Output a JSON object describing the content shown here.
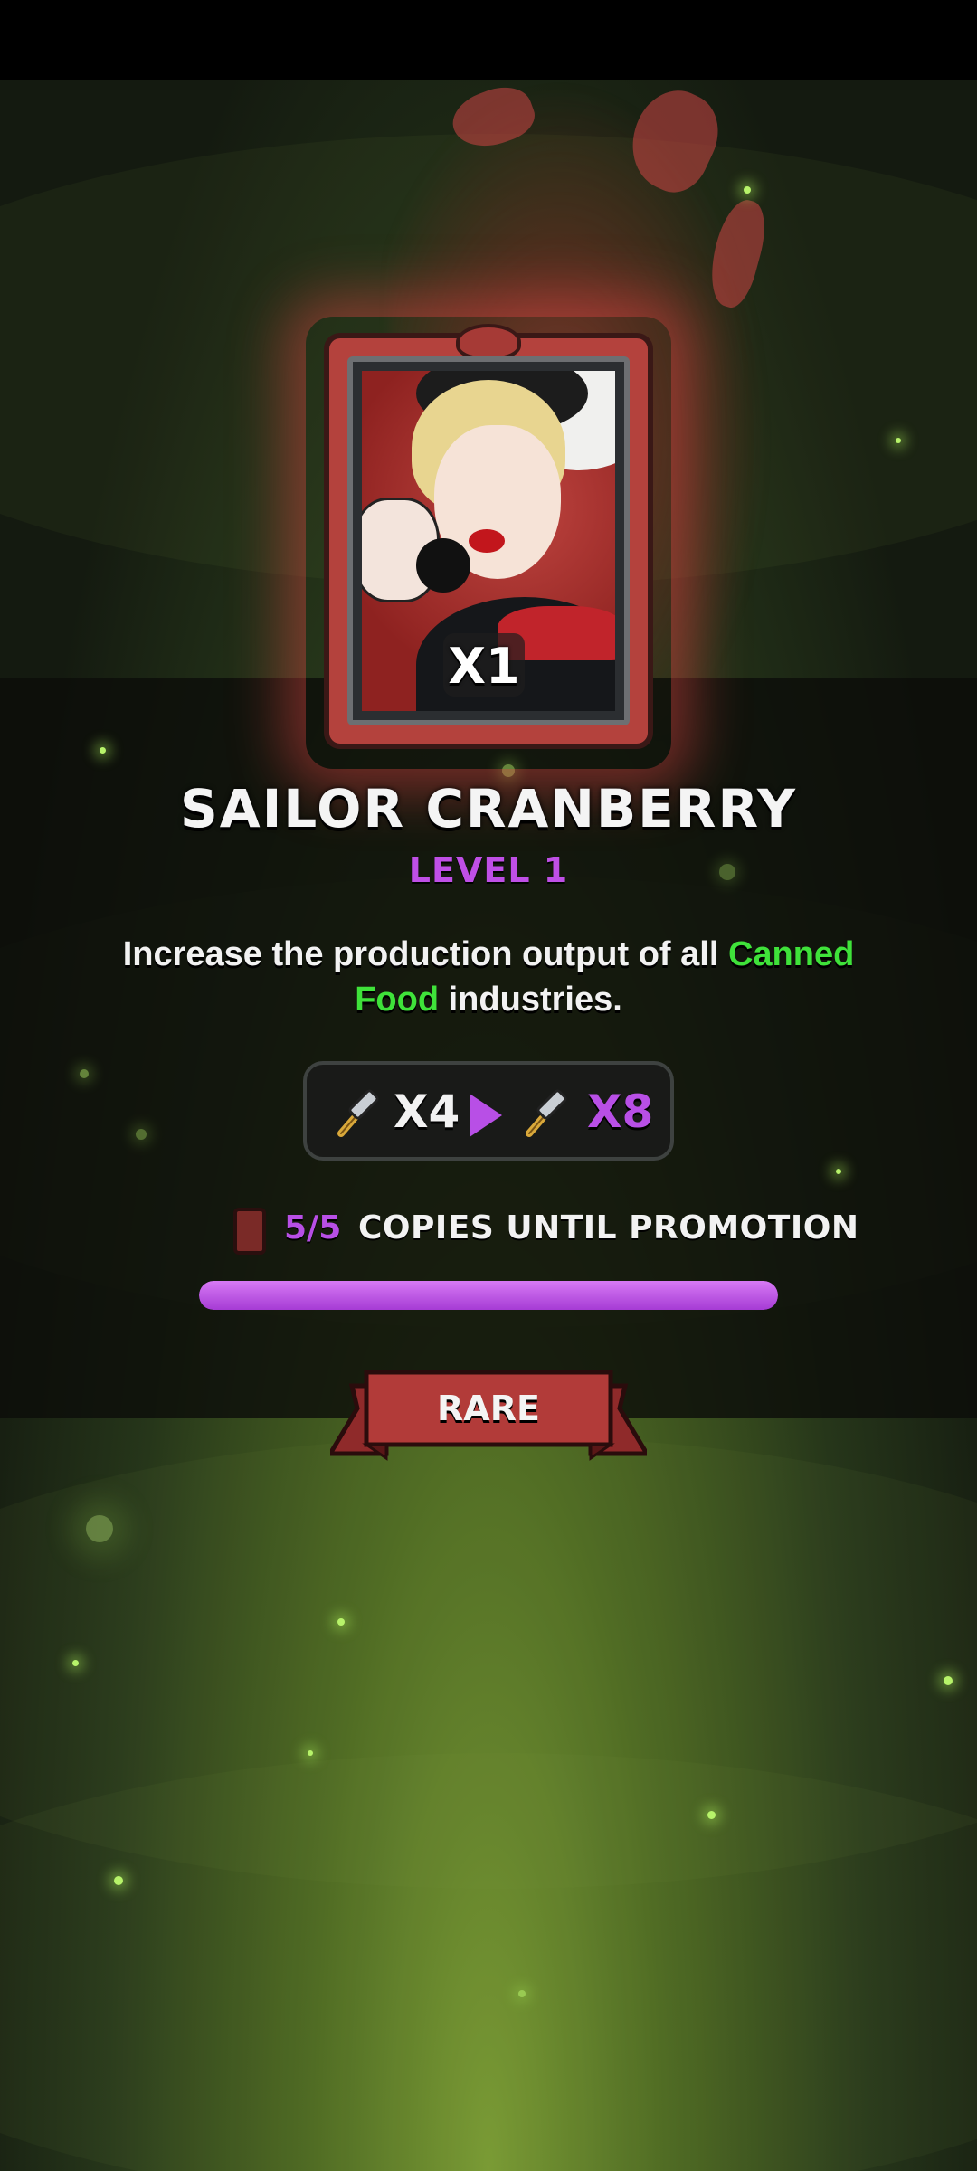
{
  "card": {
    "name": "SAILOR CRANBERRY",
    "level": "LEVEL 1",
    "copies_owned": "X1",
    "rarity": "RARE"
  },
  "description": {
    "before": "Increase the production output of all ",
    "highlight": "Canned Food",
    "after": " industries."
  },
  "boost": {
    "current": "X4",
    "next": "X8",
    "icon": "hammer-icon"
  },
  "promotion": {
    "count": "5/5",
    "label": "COPIES UNTIL PROMOTION",
    "progress": 1.0
  },
  "colors": {
    "accent_purple": "#b84fe6",
    "highlight_green": "#3fe23a",
    "card_red": "#b4423d"
  }
}
